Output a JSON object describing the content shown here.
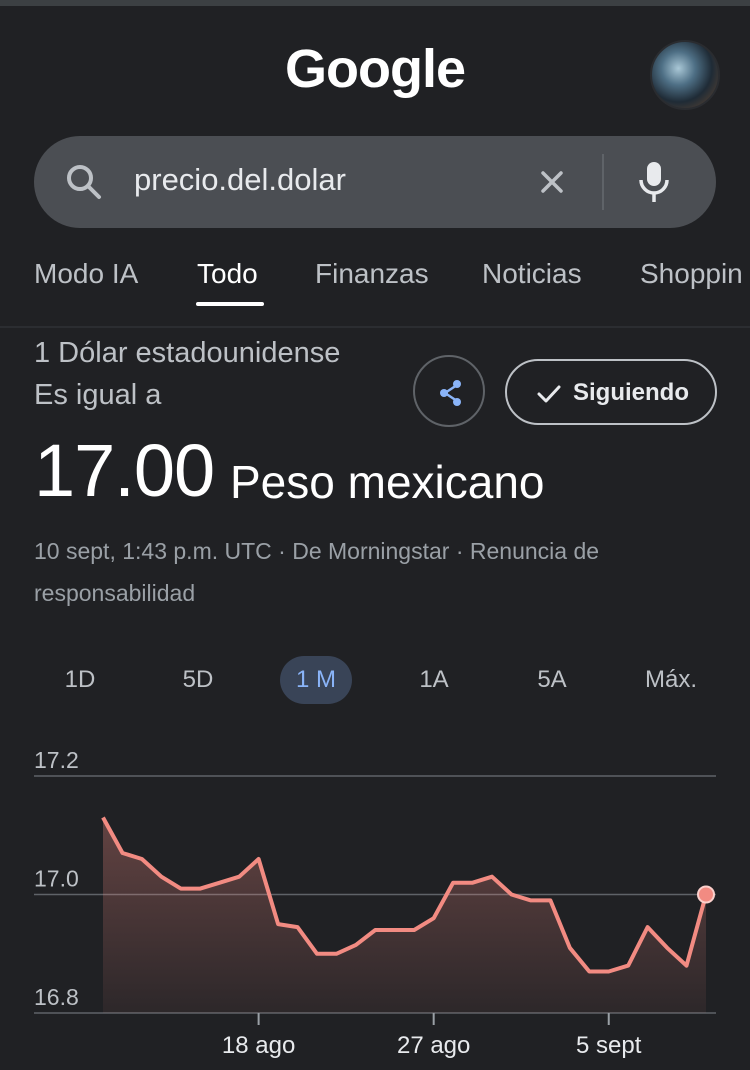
{
  "header": {
    "logo_text": "Google"
  },
  "search": {
    "query": "precio.del.dolar"
  },
  "tabs": [
    {
      "label": "Modo IA"
    },
    {
      "label": "Todo"
    },
    {
      "label": "Finanzas"
    },
    {
      "label": "Noticias"
    },
    {
      "label": "Shoppin"
    }
  ],
  "result": {
    "label": "1 Dólar estadounidense Es igual a",
    "value": "17.00",
    "unit": "Peso mexicano",
    "meta": "10 sept, 1:43 p.m. UTC · De Morningstar · Renuncia de responsabilidad",
    "follow_label": "Siguiendo"
  },
  "ranges": [
    {
      "label": "1D"
    },
    {
      "label": "5D"
    },
    {
      "label": "1 M"
    },
    {
      "label": "1A"
    },
    {
      "label": "5A"
    },
    {
      "label": "Máx."
    }
  ],
  "active_range": "1 M",
  "chart_data": {
    "type": "area",
    "ytick_labels": [
      "17.2",
      "17.0",
      "16.8"
    ],
    "ytick_values": [
      17.2,
      17.0,
      16.8
    ],
    "ylim": [
      16.8,
      17.2
    ],
    "xtick_labels": [
      "18 ago",
      "27 ago",
      "5 sept"
    ],
    "xtick_index": [
      8,
      17,
      26
    ],
    "grid": true,
    "line_color": "#f28b82",
    "values": [
      17.13,
      17.07,
      17.06,
      17.03,
      17.01,
      17.01,
      17.02,
      17.03,
      17.06,
      16.95,
      16.945,
      16.9,
      16.9,
      16.915,
      16.94,
      16.94,
      16.94,
      16.96,
      17.02,
      17.02,
      17.03,
      17.0,
      16.99,
      16.99,
      16.91,
      16.87,
      16.87,
      16.88,
      16.945,
      16.91,
      16.88,
      17.0
    ]
  },
  "colors": {
    "background": "#202124",
    "accent": "#8ab4f8",
    "chart_line": "#f28b82"
  }
}
